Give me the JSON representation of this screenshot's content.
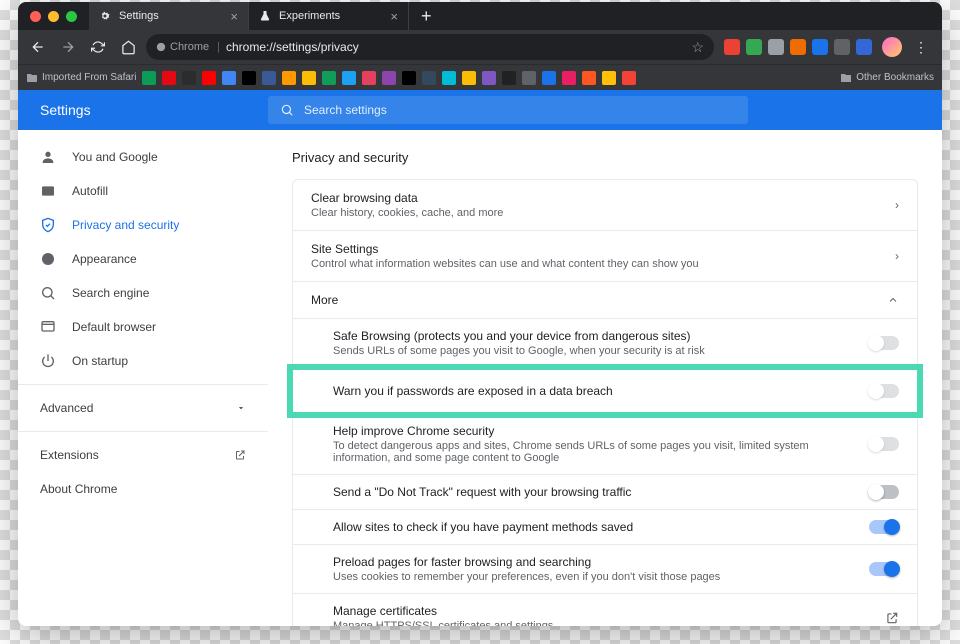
{
  "tabs": [
    {
      "label": "Settings",
      "active": true
    },
    {
      "label": "Experiments",
      "active": false
    }
  ],
  "omnibox": {
    "secure_label": "Chrome",
    "url": "chrome://settings/privacy"
  },
  "bookmarks": {
    "imported": "Imported From Safari",
    "other": "Other Bookmarks"
  },
  "header": {
    "title": "Settings",
    "search_placeholder": "Search settings"
  },
  "sidebar": {
    "items": [
      {
        "label": "You and Google",
        "icon": "person"
      },
      {
        "label": "Autofill",
        "icon": "autofill"
      },
      {
        "label": "Privacy and security",
        "icon": "shield",
        "active": true
      },
      {
        "label": "Appearance",
        "icon": "palette"
      },
      {
        "label": "Search engine",
        "icon": "search"
      },
      {
        "label": "Default browser",
        "icon": "browser"
      },
      {
        "label": "On startup",
        "icon": "power"
      }
    ],
    "advanced": "Advanced",
    "extensions": "Extensions",
    "about": "About Chrome"
  },
  "main": {
    "section_title": "Privacy and security",
    "top_rows": [
      {
        "title": "Clear browsing data",
        "sub": "Clear history, cookies, cache, and more"
      },
      {
        "title": "Site Settings",
        "sub": "Control what information websites can use and what content they can show you"
      }
    ],
    "more_label": "More",
    "subitems": [
      {
        "title": "Safe Browsing (protects you and your device from dangerous sites)",
        "sub": "Sends URLs of some pages you visit to Google, when your security is at risk",
        "control": "toggle",
        "state": "disabled"
      },
      {
        "title": "Warn you if passwords are exposed in a data breach",
        "sub": "",
        "control": "toggle",
        "state": "disabled",
        "highlight": true
      },
      {
        "title": "Help improve Chrome security",
        "sub": "To detect dangerous apps and sites, Chrome sends URLs of some pages you visit, limited system information, and some page content to Google",
        "control": "toggle",
        "state": "disabled"
      },
      {
        "title": "Send a \"Do Not Track\" request with your browsing traffic",
        "sub": "",
        "control": "toggle",
        "state": "off"
      },
      {
        "title": "Allow sites to check if you have payment methods saved",
        "sub": "",
        "control": "toggle",
        "state": "on"
      },
      {
        "title": "Preload pages for faster browsing and searching",
        "sub": "Uses cookies to remember your preferences, even if you don't visit those pages",
        "control": "toggle",
        "state": "on"
      },
      {
        "title": "Manage certificates",
        "sub": "Manage HTTPS/SSL certificates and settings",
        "control": "open"
      }
    ]
  }
}
